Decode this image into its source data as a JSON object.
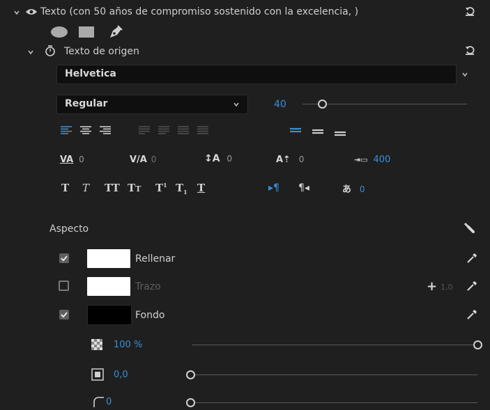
{
  "layer": {
    "title": "Texto (con 50 años de compromiso sostenido con la excelencia, )"
  },
  "source_text": {
    "label": "Texto de origen"
  },
  "font": {
    "family": "Helvetica",
    "style": "Regular",
    "size": "40",
    "size_slider_fraction": 0.12
  },
  "metrics": {
    "kerning": "0",
    "tracking": "0",
    "leading": "0",
    "baseline": "0",
    "tsume": "400",
    "shift": "0"
  },
  "appearance": {
    "header": "Aspecto",
    "fill": {
      "label": "Rellenar",
      "checked": true,
      "color": "#ffffff"
    },
    "stroke": {
      "label": "Trazo",
      "checked": false,
      "color": "#ffffff",
      "width": "1,0"
    },
    "background": {
      "label": "Fondo",
      "checked": true,
      "color": "#000000"
    },
    "opacity": "100 %",
    "size": "0,0",
    "corner": "0"
  },
  "colors": {
    "accent": "#3b8ed8",
    "panel": "#1f1f1f",
    "field": "#0f0f0f"
  }
}
